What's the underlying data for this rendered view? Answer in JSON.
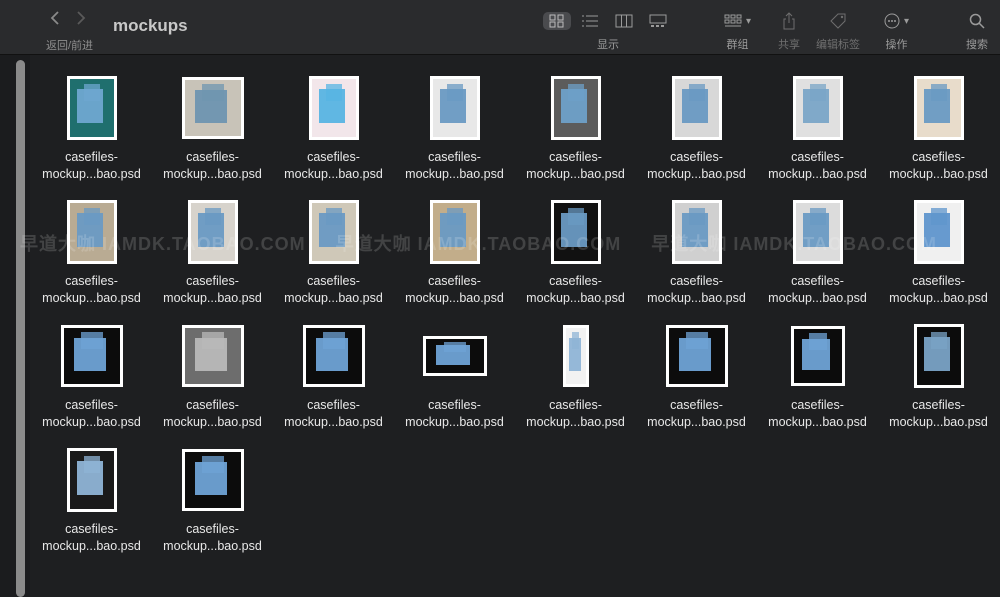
{
  "window": {
    "title": "mockups",
    "nav_label": "返回/前进",
    "view_label": "显示",
    "group_label": "群组",
    "share_label": "共享",
    "tags_label": "编辑标签",
    "action_label": "操作",
    "search_label": "搜索"
  },
  "watermark": {
    "segments": [
      "早道大咖  IAMDK.TAOBAO.COM",
      "早道大咖  IAMDK.TAOBAO.COM",
      "早道大咖  IAMDK.TAOBAO.COM"
    ]
  },
  "files": [
    {
      "line1": "casefiles-",
      "line2": "mockup...bao.psd",
      "bg": "#1f6f6e",
      "tone": "#6fa7d0",
      "shape": "portrait"
    },
    {
      "line1": "casefiles-",
      "line2": "mockup...bao.psd",
      "bg": "#c8c3b8",
      "tone": "#6f95b0",
      "shape": "landscape"
    },
    {
      "line1": "casefiles-",
      "line2": "mockup...bao.psd",
      "bg": "#f2e6ea",
      "tone": "#57b4e3",
      "shape": "portrait"
    },
    {
      "line1": "casefiles-",
      "line2": "mockup...bao.psd",
      "bg": "#e8e8e8",
      "tone": "#6a9ac3",
      "shape": "portrait"
    },
    {
      "line1": "casefiles-",
      "line2": "mockup...bao.psd",
      "bg": "#5c5c5c",
      "tone": "#6ea0c8",
      "shape": "portrait"
    },
    {
      "line1": "casefiles-",
      "line2": "mockup...bao.psd",
      "bg": "#d8d8d8",
      "tone": "#6a9ac3",
      "shape": "portrait"
    },
    {
      "line1": "casefiles-",
      "line2": "mockup...bao.psd",
      "bg": "#e0e0e0",
      "tone": "#7aa5c7",
      "shape": "portrait"
    },
    {
      "line1": "casefiles-",
      "line2": "mockup...bao.psd",
      "bg": "#e8dccb",
      "tone": "#6a9ac3",
      "shape": "portrait"
    },
    {
      "line1": "casefiles-",
      "line2": "mockup...bao.psd",
      "bg": "#b9ab93",
      "tone": "#6a9ac3",
      "shape": "portrait"
    },
    {
      "line1": "casefiles-",
      "line2": "mockup...bao.psd",
      "bg": "#d7d3cc",
      "tone": "#6a9ac3",
      "shape": "portrait"
    },
    {
      "line1": "casefiles-",
      "line2": "mockup...bao.psd",
      "bg": "#cfc8b8",
      "tone": "#6a9ac3",
      "shape": "portrait"
    },
    {
      "line1": "casefiles-",
      "line2": "mockup...bao.psd",
      "bg": "#c2ad8a",
      "tone": "#6a9ac3",
      "shape": "portrait"
    },
    {
      "line1": "casefiles-",
      "line2": "mockup...bao.psd",
      "bg": "#111111",
      "tone": "#6a9ac3",
      "shape": "portrait"
    },
    {
      "line1": "casefiles-",
      "line2": "mockup...bao.psd",
      "bg": "#d0d0d0",
      "tone": "#6a9ac3",
      "shape": "portrait"
    },
    {
      "line1": "casefiles-",
      "line2": "mockup...bao.psd",
      "bg": "#dcdcdc",
      "tone": "#6a9ac3",
      "shape": "portrait"
    },
    {
      "line1": "casefiles-",
      "line2": "mockup...bao.psd",
      "bg": "#f0f0f0",
      "tone": "#5f95cc",
      "shape": "portrait"
    },
    {
      "line1": "casefiles-",
      "line2": "mockup...bao.psd",
      "bg": "#0c0c0c",
      "tone": "#6fa3d6",
      "shape": "landscape"
    },
    {
      "line1": "casefiles-",
      "line2": "mockup...bao.psd",
      "bg": "#6d6d6d",
      "tone": "#b9b9b9",
      "shape": "landscape"
    },
    {
      "line1": "casefiles-",
      "line2": "mockup...bao.psd",
      "bg": "#0c0c0c",
      "tone": "#6fa3d6",
      "shape": "landscape"
    },
    {
      "line1": "casefiles-",
      "line2": "mockup...bao.psd",
      "bg": "#0c0c0c",
      "tone": "#6fa3d6",
      "shape": "wide"
    },
    {
      "line1": "casefiles-",
      "line2": "mockup...bao.psd",
      "bg": "#f2f2f2",
      "tone": "#8fb4d6",
      "shape": "tall"
    },
    {
      "line1": "casefiles-",
      "line2": "mockup...bao.psd",
      "bg": "#0c0c0c",
      "tone": "#6fa3d6",
      "shape": "landscape"
    },
    {
      "line1": "casefiles-",
      "line2": "mockup...bao.psd",
      "bg": "#0c0c0c",
      "tone": "#6fa3d6",
      "shape": "square"
    },
    {
      "line1": "casefiles-",
      "line2": "mockup...bao.psd",
      "bg": "#0c0c0c",
      "tone": "#7aa3c6",
      "shape": "portrait"
    },
    {
      "line1": "casefiles-",
      "line2": "mockup...bao.psd",
      "bg": "#1a1a1a",
      "tone": "#8fb4d6",
      "shape": "portrait"
    },
    {
      "line1": "casefiles-",
      "line2": "mockup...bao.psd",
      "bg": "#0c0c0c",
      "tone": "#6fa3d6",
      "shape": "landscape"
    }
  ]
}
